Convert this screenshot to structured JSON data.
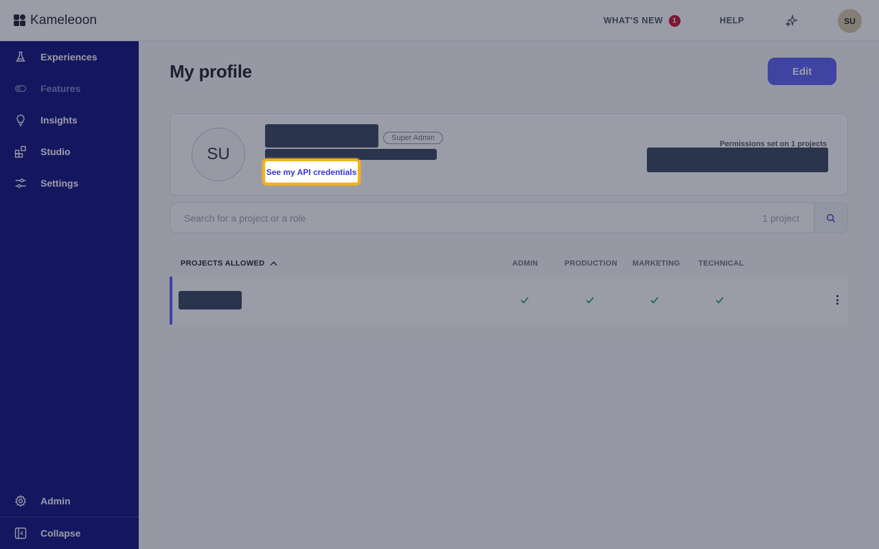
{
  "brand": {
    "name": "Kameleoon"
  },
  "topbar": {
    "whats_new": "WHAT'S NEW",
    "whats_new_count": "1",
    "help": "HELP",
    "user_initials": "SU"
  },
  "sidebar": {
    "items": [
      {
        "label": "Experiences",
        "icon": "flask-icon",
        "enabled": true
      },
      {
        "label": "Features",
        "icon": "toggle-icon",
        "enabled": false
      },
      {
        "label": "Insights",
        "icon": "lightbulb-icon",
        "enabled": true
      },
      {
        "label": "Studio",
        "icon": "blocks-icon",
        "enabled": true
      },
      {
        "label": "Settings",
        "icon": "sliders-icon",
        "enabled": true
      }
    ],
    "admin": "Admin",
    "collapse": "Collapse"
  },
  "page": {
    "title": "My profile",
    "edit": "Edit"
  },
  "profile": {
    "initials": "SU",
    "role": "Super Admin",
    "api_link": "See my API credentials",
    "permissions_label": "Permissions set on 1 projects"
  },
  "search": {
    "placeholder": "Search for a project or a role",
    "count": "1 project"
  },
  "table": {
    "columns": [
      "PROJECTS ALLOWED",
      "ADMIN",
      "PRODUCTION",
      "MARKETING",
      "TECHNICAL"
    ],
    "rows": [
      {
        "admin": true,
        "production": true,
        "marketing": true,
        "technical": true
      }
    ]
  },
  "colors": {
    "sidebar": "#0d0c7f",
    "accent": "#5a5ef5",
    "highlight": "#f5b21c",
    "check": "#1aa37a",
    "badge": "#c8102e"
  }
}
